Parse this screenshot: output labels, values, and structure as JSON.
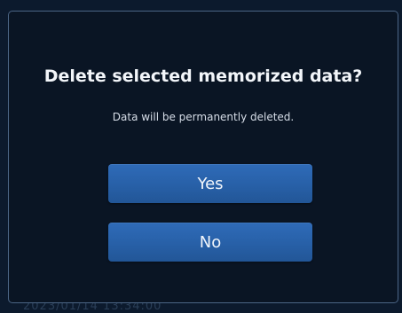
{
  "dialog": {
    "title": "Delete selected memorized data?",
    "message": "Data will be permanently deleted.",
    "yes_label": "Yes",
    "no_label": "No"
  },
  "background": {
    "ghost_text": "2023/01/14  13:34:00"
  },
  "colors": {
    "background": "#0c1a2d",
    "dialog_border": "#4b6585",
    "button": "#2a64ae",
    "text": "#f3f6fa"
  }
}
